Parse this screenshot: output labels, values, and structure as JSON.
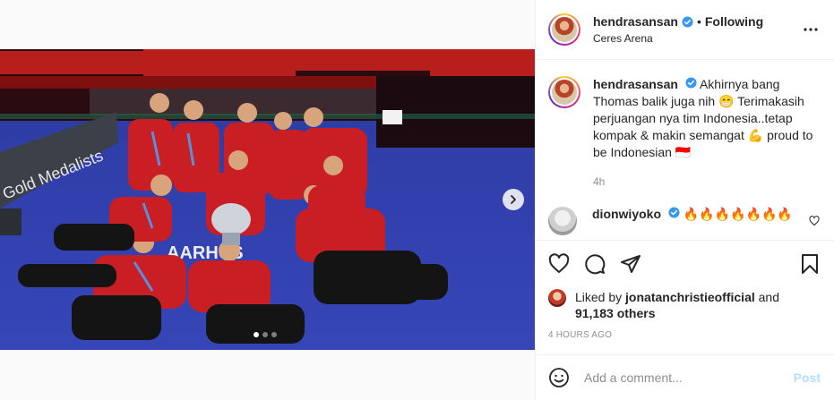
{
  "post": {
    "username": "hendrasansan",
    "separator": "•",
    "follow_state": "Following",
    "location": "Ceres Arena",
    "more_icon": "more-horizontal-icon"
  },
  "caption": {
    "username": "hendrasansan",
    "text": "Akhirnya bang Thomas balik juga nih 😁 Terimakasih perjuangan nya tim Indonesia..tetap kompak & makin semangat 💪 proud to be Indonesian 🇮🇩",
    "time": "4h"
  },
  "comments": [
    {
      "username": "dionwiyoko",
      "text": "🔥🔥🔥🔥🔥🔥🔥"
    }
  ],
  "photo": {
    "banner_text": "Gold Medalists",
    "floor_text": "AARHUS"
  },
  "carousel": {
    "slide_count": 3,
    "active_index": 0
  },
  "actions": {
    "like_icon": "heart-icon",
    "comment_icon": "comment-icon",
    "share_icon": "send-icon",
    "save_icon": "bookmark-icon"
  },
  "likes": {
    "prefix": "Liked by",
    "liker": "jonatanchristieofficial",
    "connector": "and",
    "others": "91,183 others"
  },
  "timestamp": "4 HOURS AGO",
  "add_comment": {
    "placeholder": "Add a comment...",
    "post_label": "Post"
  },
  "colors": {
    "verified": "#3897f0",
    "post_disabled": "#b2dffc",
    "muted": "#8e8e8e"
  }
}
